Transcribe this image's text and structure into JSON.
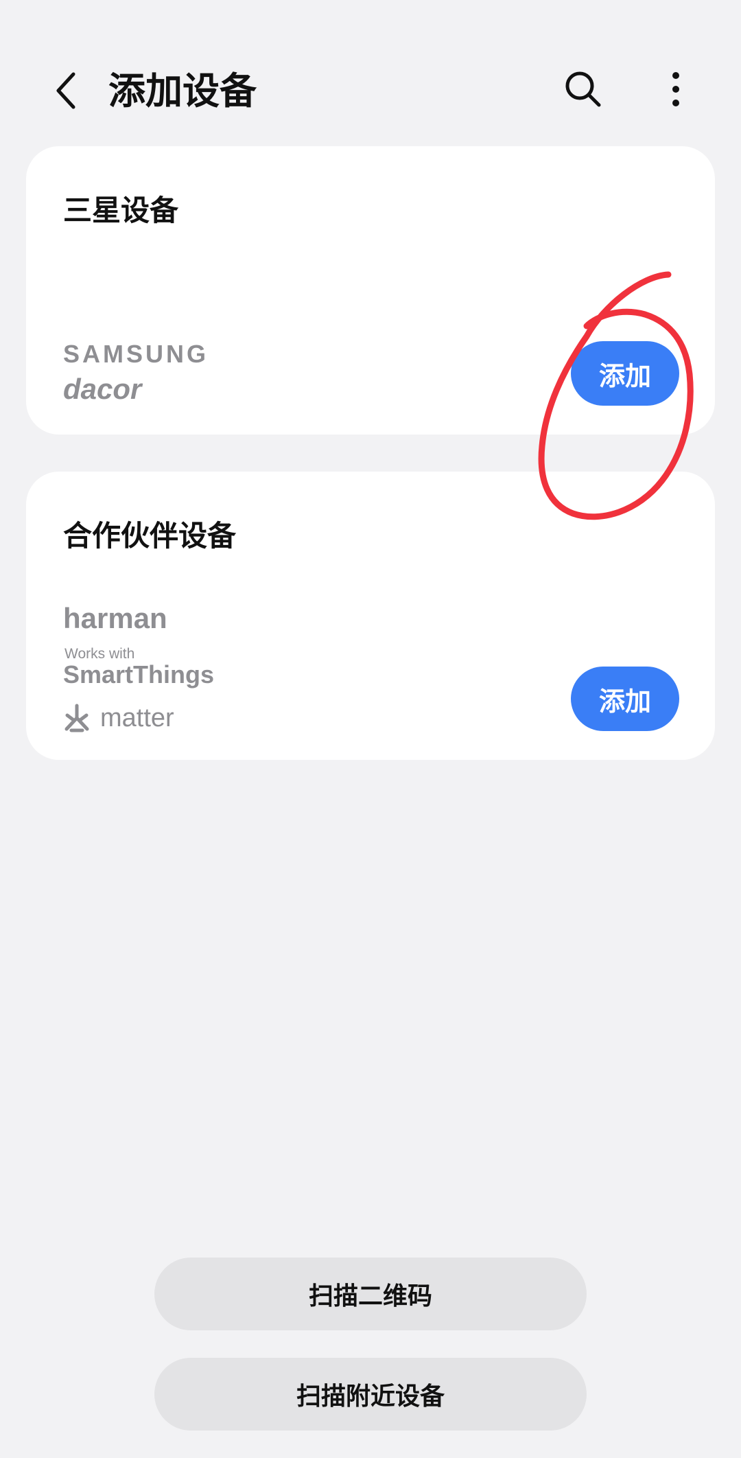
{
  "header": {
    "title": "添加设备",
    "back_icon": "chevron-left-icon",
    "search_icon": "search-icon",
    "more_icon": "more-vertical-icon"
  },
  "cards": {
    "samsung": {
      "title": "三星设备",
      "brands": [
        "SAMSUNG",
        "dacor"
      ],
      "add_label": "添加"
    },
    "partner": {
      "title": "合作伙伴设备",
      "brand_harman": "harman",
      "brand_works_with": "Works with",
      "brand_smartthings": "SmartThings",
      "brand_matter": "matter",
      "add_label": "添加"
    }
  },
  "bottom": {
    "scan_qr_label": "扫描二维码",
    "scan_nearby_label": "扫描附近设备"
  },
  "colors": {
    "accent": "#3a7ef6",
    "background": "#f2f2f4",
    "card": "#ffffff",
    "brand_gray": "#8e8e92",
    "annotation_red": "#f0323c"
  }
}
